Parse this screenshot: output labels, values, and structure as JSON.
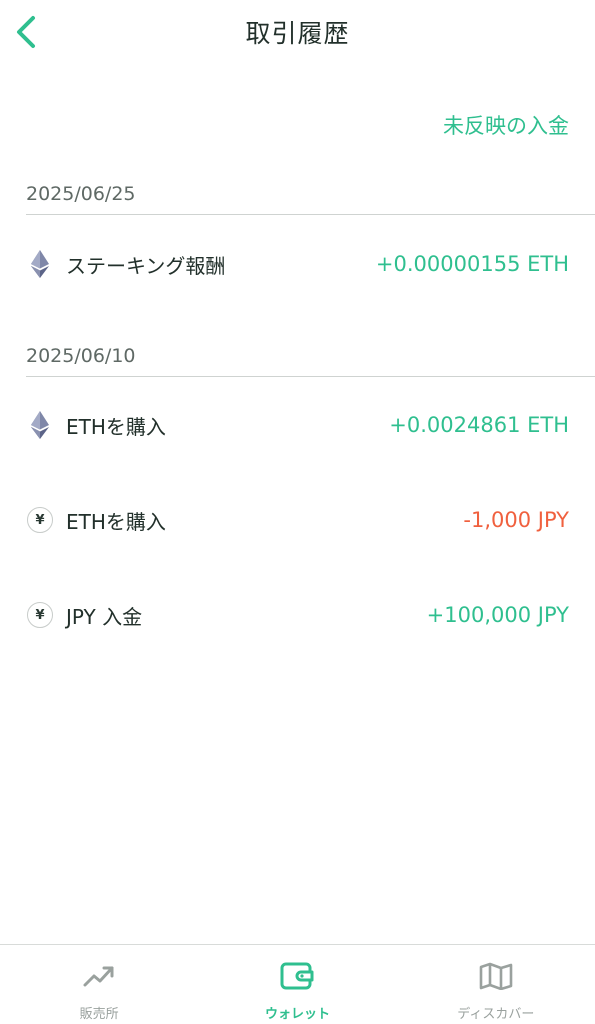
{
  "header": {
    "title": "取引履歴",
    "back_icon": "chevron-left-icon"
  },
  "pending_link": "未反映の入金",
  "groups": [
    {
      "date": "2025/06/25",
      "items": [
        {
          "icon": "eth-icon",
          "label": "ステーキング報酬",
          "amount": "+0.00000155 ETH",
          "status": "positive"
        }
      ]
    },
    {
      "date": "2025/06/10",
      "items": [
        {
          "icon": "eth-icon",
          "label": "ETHを購入",
          "amount": "+0.0024861 ETH",
          "status": "positive"
        },
        {
          "icon": "yen-icon",
          "label": "ETHを購入",
          "amount": "-1,000 JPY",
          "status": "negative"
        },
        {
          "icon": "yen-icon",
          "label": "JPY 入金",
          "amount": "+100,000 JPY",
          "status": "positive"
        }
      ]
    }
  ],
  "yen_symbol": "¥",
  "tabbar": [
    {
      "label": "販売所",
      "icon": "trend-chart-icon",
      "active": false
    },
    {
      "label": "ウォレット",
      "icon": "wallet-icon",
      "active": true
    },
    {
      "label": "ディスカバー",
      "icon": "map-icon",
      "active": false
    }
  ],
  "colors": {
    "accent": "#2fbf8f",
    "negative": "#f0603e",
    "text": "#22302b",
    "muted": "#5f6965"
  }
}
